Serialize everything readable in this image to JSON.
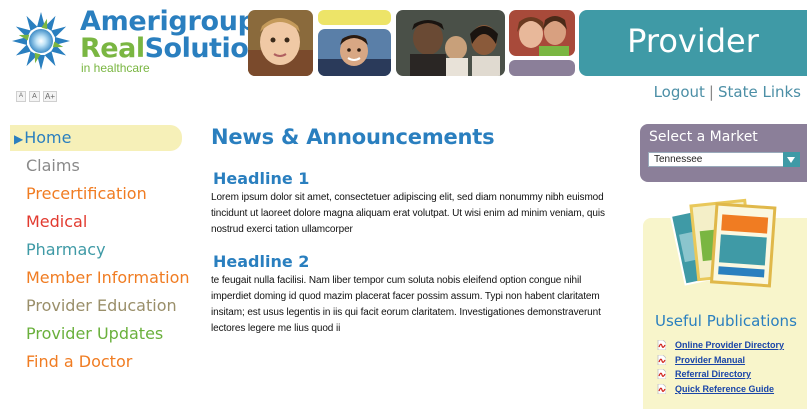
{
  "header": {
    "logo": {
      "line1": "Amerigroup",
      "line2a": "Real",
      "line2b": "Solutions",
      "trademark": "®",
      "line3": "in healthcare"
    },
    "portal_title": "Provider",
    "font_sizes": [
      "A",
      "A",
      "A+"
    ],
    "links": {
      "logout": "Logout",
      "separator": "|",
      "state_links": "State Links"
    }
  },
  "colors": {
    "teal": "#3f9aa6",
    "blue": "#2a7fbf",
    "green": "#7ab642",
    "orange": "#f07c22",
    "purple": "#8b7f99",
    "gray": "#8a8a8a"
  },
  "nav": {
    "items": [
      {
        "label": "Home",
        "color": "#2a7fbf",
        "active": true
      },
      {
        "label": "Claims",
        "color": "#8a8a8a"
      },
      {
        "label": "Precertification",
        "color": "#f07c22"
      },
      {
        "label": "Medical",
        "color": "#e23a2f"
      },
      {
        "label": "Pharmacy",
        "color": "#3f9aa6"
      },
      {
        "label": "Member Information",
        "color": "#f07c22"
      },
      {
        "label": "Provider Education",
        "color": "#9a8f6a"
      },
      {
        "label": "Provider Updates",
        "color": "#6ab03c"
      },
      {
        "label": "Find a Doctor",
        "color": "#f07c22"
      }
    ]
  },
  "main": {
    "title": "News & Announcements",
    "articles": [
      {
        "headline": "Headline 1",
        "body": "Lorem ipsum dolor sit amet, consectetuer adipiscing elit, sed diam nonummy nibh euismod tincidunt ut laoreet dolore magna aliquam erat volutpat. Ut wisi enim ad minim veniam, quis nostrud exerci tation ullamcorper"
      },
      {
        "headline": "Headline 2",
        "body": "te feugait nulla facilisi. Nam liber tempor cum soluta nobis eleifend option congue nihil imperdiet doming id quod mazim placerat facer possim assum. Typi non habent claritatem insitam; est usus legentis in iis qui facit eorum claritatem. Investigationes demonstraverunt lectores legere me lius quod ii"
      }
    ]
  },
  "market": {
    "title": "Select a Market",
    "selected": "Tennessee"
  },
  "publications": {
    "title": "Useful Publications",
    "items": [
      "Online Provider Directory",
      "Provider Manual",
      "Referral Directory",
      "Quick Reference Guide"
    ]
  }
}
